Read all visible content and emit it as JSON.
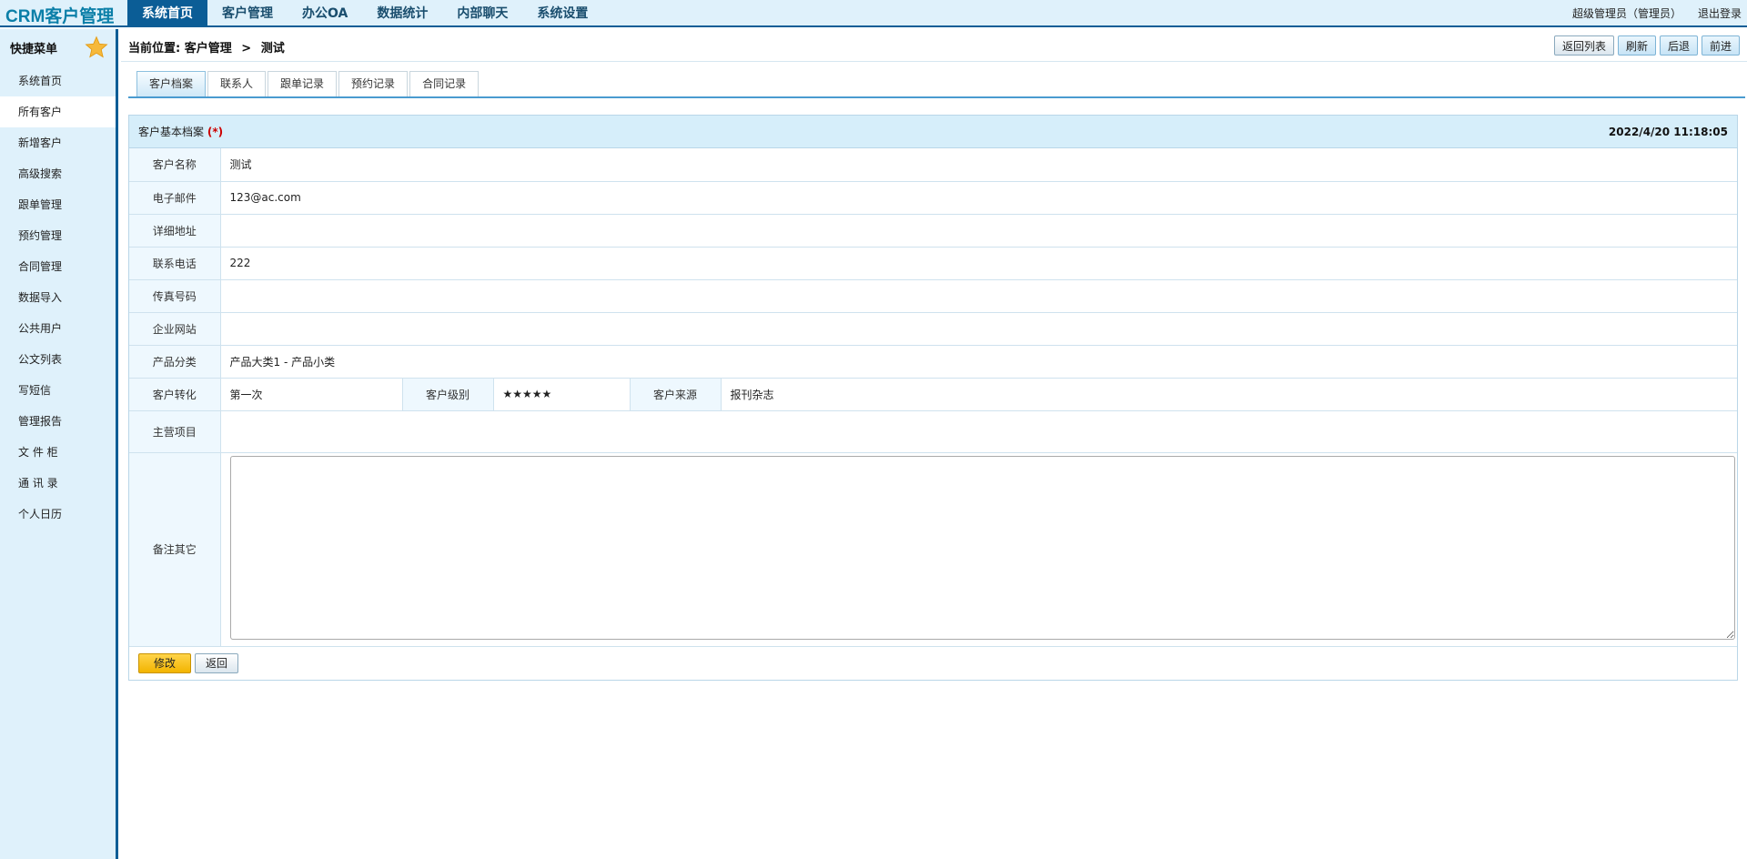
{
  "app": {
    "logo": "CRM客户管理"
  },
  "nav": [
    "系统首页",
    "客户管理",
    "办公OA",
    "数据统计",
    "内部聊天",
    "系统设置"
  ],
  "user": {
    "name": "超级管理员（管理员）",
    "logout": "退出登录"
  },
  "sidebar": {
    "title": "快捷菜单",
    "items": [
      "系统首页",
      "所有客户",
      "新增客户",
      "高级搜索",
      "跟单管理",
      "预约管理",
      "合同管理",
      "数据导入",
      "公共用户",
      "公文列表",
      "写短信",
      "管理报告",
      "文 件 柜",
      "通 讯 录",
      "个人日历"
    ],
    "active_index": 1
  },
  "breadcrumb": {
    "label": "当前位置:",
    "section": "客户管理",
    "separator": ">",
    "page": "测试"
  },
  "actions": {
    "back_list": "返回列表",
    "refresh": "刷新",
    "back": "后退",
    "forward": "前进"
  },
  "tabs": [
    "客户档案",
    "联系人",
    "跟单记录",
    "预约记录",
    "合同记录"
  ],
  "panel": {
    "title": "客户基本档案",
    "required_mark": "(*)",
    "date": "2022/4/20 11:18:05"
  },
  "fields": {
    "name_label": "客户名称",
    "name": "测试",
    "email_label": "电子邮件",
    "email": "123@ac.com",
    "address_label": "详细地址",
    "address": "",
    "phone_label": "联系电话",
    "phone": "222",
    "fax_label": "传真号码",
    "fax": "",
    "website_label": "企业网站",
    "website": "",
    "category_label": "产品分类",
    "category": "产品大类1 - 产品小类",
    "conversion_label": "客户转化",
    "conversion": "第一次",
    "level_label": "客户级别",
    "level": "★★★★★",
    "source_label": "客户来源",
    "source": "报刊杂志",
    "business_label": "主营项目",
    "business": "",
    "remark_label": "备注其它",
    "remark": ""
  },
  "footer": {
    "save": "修改",
    "return": "返回"
  },
  "colors": {
    "nav_active": "#0b5d96",
    "header_bg": "#dff1fb",
    "logo": "#0b7fa8",
    "save_button": "#f2b400"
  }
}
